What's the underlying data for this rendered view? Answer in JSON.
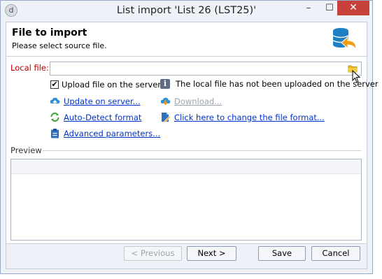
{
  "window": {
    "title": "List import 'List 26 (LST25)'",
    "minimize_glyph": "–",
    "maximize_glyph": "☐",
    "close_glyph": "✕"
  },
  "header": {
    "title": "File to import",
    "subtitle": "Please select source file."
  },
  "local_file": {
    "label": "Local file:",
    "value": "",
    "placeholder": ""
  },
  "options": {
    "upload_checkbox_label": "Upload file on the server",
    "upload_checked": true,
    "info_text": "The local file has not been uploaded on the server",
    "update_on_server": "Update on server...",
    "download": "Download...",
    "auto_detect": "Auto-Detect format",
    "change_format": "Click here to change the file format...",
    "advanced_parameters": "Advanced parameters..."
  },
  "preview": {
    "label": "Preview"
  },
  "buttons": {
    "previous": "< Previous",
    "next": "Next >",
    "save": "Save",
    "cancel": "Cancel"
  },
  "colors": {
    "accent": "#0033cc",
    "required_label": "#c00000",
    "close_button": "#c7413b",
    "window_bg": "#eef2f8"
  },
  "icons": [
    "app-icon",
    "database-import-icon",
    "folder-icon",
    "mouse-cursor-icon",
    "info-icon",
    "cloud-upload-icon",
    "cloud-download-icon",
    "refresh-icon",
    "change-format-icon",
    "clipboard-icon"
  ]
}
